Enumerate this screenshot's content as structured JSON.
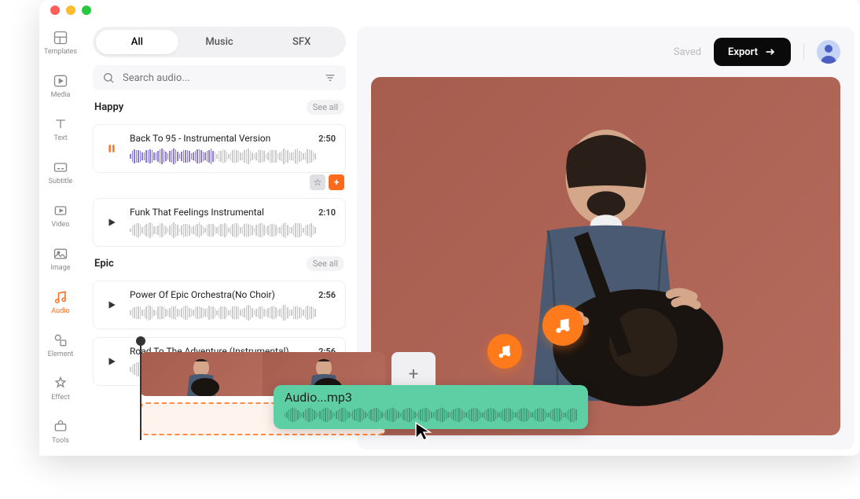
{
  "sidenav": [
    {
      "label": "Templates"
    },
    {
      "label": "Media"
    },
    {
      "label": "Text"
    },
    {
      "label": "Subtitle"
    },
    {
      "label": "Video"
    },
    {
      "label": "Image"
    },
    {
      "label": "Audio"
    },
    {
      "label": "Element"
    },
    {
      "label": "Effect"
    },
    {
      "label": "Tools"
    }
  ],
  "tabs": {
    "all": "All",
    "music": "Music",
    "sfx": "SFX"
  },
  "search": {
    "placeholder": "Search audio..."
  },
  "categories": [
    {
      "title": "Happy",
      "see_all": "See all",
      "tracks": [
        {
          "title": "Back To 95 - Instrumental Version",
          "duration": "2:50",
          "playing": true
        },
        {
          "title": "Funk That Feelings Instrumental",
          "duration": "2:10",
          "playing": false
        }
      ]
    },
    {
      "title": "Epic",
      "see_all": "See all",
      "tracks": [
        {
          "title": "Power Of Epic Orchestra(No Choir)",
          "duration": "2:56",
          "playing": false
        },
        {
          "title": "Road To The Adventure (Instrumental)",
          "duration": "2:56",
          "playing": false
        }
      ]
    }
  ],
  "header": {
    "saved": "Saved",
    "export": "Export"
  },
  "timeline": {
    "audio_clip_name": "Audio...mp3",
    "add_label": "+"
  }
}
